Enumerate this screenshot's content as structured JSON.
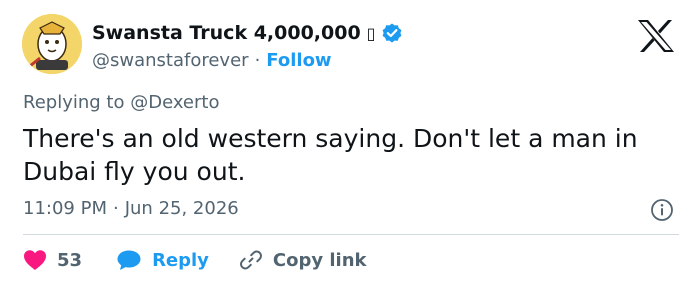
{
  "author": {
    "display_name": "Swansta Truck 4,000,000",
    "name_glyph": "▯",
    "handle": "@swanstaforever",
    "separator": "·",
    "follow_label": "Follow",
    "verified": true
  },
  "reply_context": {
    "prefix": "Replying to",
    "mention": "@Dexerto"
  },
  "tweet": {
    "text": "There's an old western saying. Don't let a man in Dubai fly you out.",
    "time": "11:09 PM",
    "separator": "·",
    "date": "Jun 25, 2026"
  },
  "actions": {
    "like_count": "53",
    "reply_label": "Reply",
    "copy_link_label": "Copy link"
  },
  "colors": {
    "accent": "#1d9bf0",
    "heart": "#f91880",
    "text": "#0f1419",
    "muted": "#536471"
  },
  "icons": [
    "x-logo-icon",
    "verified-badge-icon",
    "info-icon",
    "heart-icon",
    "reply-bubble-icon",
    "link-icon"
  ]
}
